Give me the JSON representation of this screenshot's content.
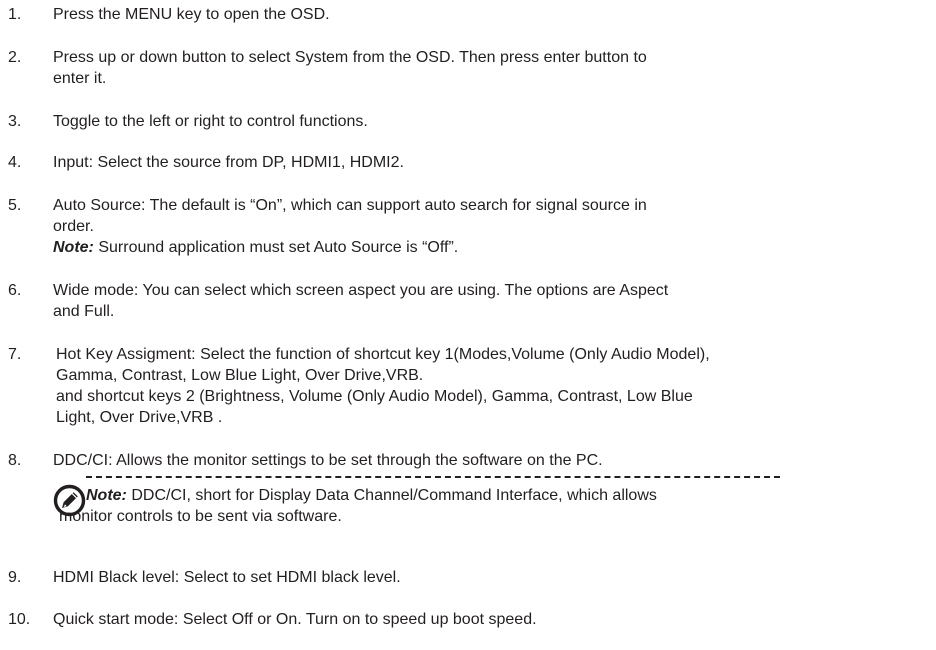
{
  "items": [
    {
      "number": "1.",
      "lines": [
        "Press the MENU key to open the OSD."
      ]
    },
    {
      "number": "2.",
      "lines": [
        "Press up or down button to select System from the OSD. Then press enter button to",
        "enter it."
      ]
    },
    {
      "number": "3.",
      "lines": [
        "Toggle to the left or right to control functions."
      ]
    },
    {
      "number": "4.",
      "lines": [
        "Input: Select the source from DP, HDMI1, HDMI2."
      ]
    },
    {
      "number": "5.",
      "lines": [
        "Auto Source: The default is “On”, which can support auto search for signal source in",
        "order."
      ],
      "note_label": "Note:",
      "note_text": " Surround application must set Auto Source is “Off”."
    },
    {
      "number": "6.",
      "lines": [
        "Wide mode: You can select which screen aspect you are using. The options are Aspect",
        "and Full."
      ]
    },
    {
      "number": "7.",
      "lines": [
        "Hot Key Assigment: Select the function of shortcut key 1(Modes,Volume (Only Audio Model),",
        "Gamma, Contrast, Low Blue Light, Over Drive,VRB.",
        "and shortcut keys 2 (Brightness, Volume (Only Audio Model), Gamma, Contrast, Low Blue",
        "Light, Over Drive,VRB ."
      ]
    },
    {
      "number": "8.",
      "lines": [
        "DDC/CI: Allows the monitor settings to be set through the software on the PC."
      ],
      "note_label": "Note:",
      "note_lines": [
        " DDC/CI, short for Display Data Channel/Command Interface, which allows",
        "monitor controls to be sent via software."
      ]
    },
    {
      "number": "9.",
      "lines": [
        "HDMI Black level: Select to set HDMI black level."
      ]
    },
    {
      "number": "10.",
      "lines": [
        "Quick start mode: Select Off or On. Turn on to speed up boot speed."
      ]
    }
  ],
  "icons": {
    "note": "note-pencil-icon"
  },
  "colors": {
    "text": "#231f20",
    "background": "#ffffff"
  }
}
